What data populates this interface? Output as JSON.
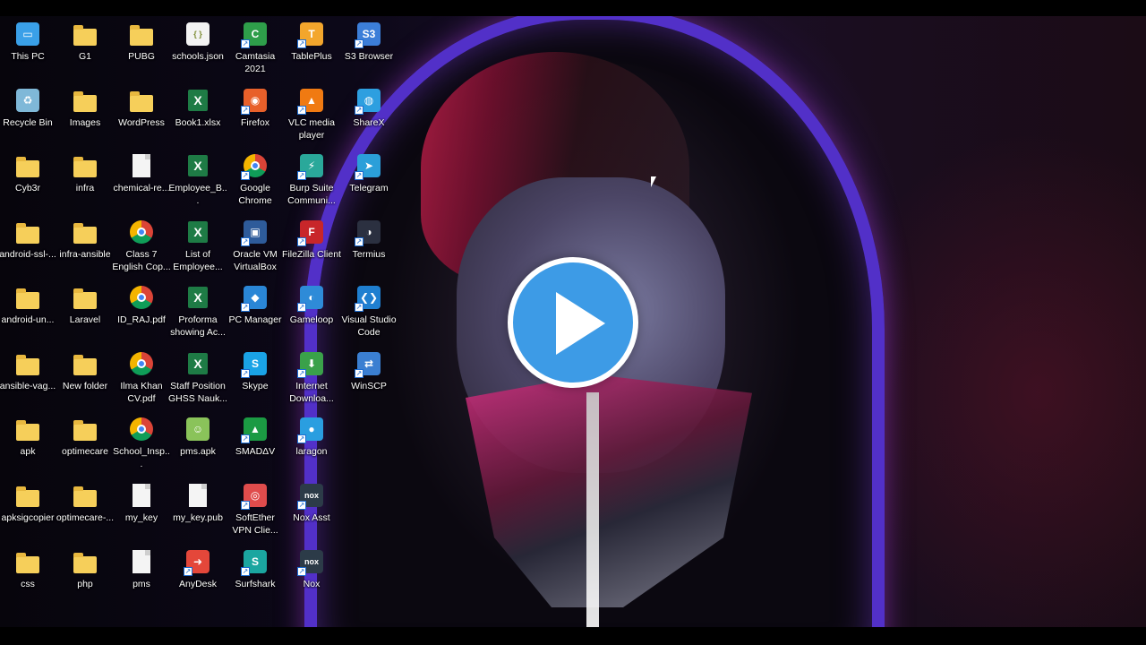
{
  "desktop": {
    "icons": [
      {
        "label": "This PC",
        "icon": "monitor-icon"
      },
      {
        "label": "Recycle Bin",
        "icon": "recycle-bin-icon"
      },
      {
        "label": "Cyb3r",
        "icon": "folder-icon"
      },
      {
        "label": "android-ssl-...",
        "icon": "folder-icon"
      },
      {
        "label": "android-un...",
        "icon": "folder-icon"
      },
      {
        "label": "ansible-vag...",
        "icon": "folder-icon"
      },
      {
        "label": "apk",
        "icon": "folder-icon"
      },
      {
        "label": "apksigcopier",
        "icon": "folder-icon"
      },
      {
        "label": "css",
        "icon": "folder-icon"
      },
      {
        "label": "G1",
        "icon": "folder-icon"
      },
      {
        "label": "Images",
        "icon": "folder-icon"
      },
      {
        "label": "infra",
        "icon": "folder-icon"
      },
      {
        "label": "infra-ansible",
        "icon": "folder-icon"
      },
      {
        "label": "Laravel",
        "icon": "folder-icon"
      },
      {
        "label": "New folder",
        "icon": "folder-icon"
      },
      {
        "label": "optimecare",
        "icon": "folder-icon"
      },
      {
        "label": "optimecare-...",
        "icon": "folder-icon"
      },
      {
        "label": "php",
        "icon": "folder-icon"
      },
      {
        "label": "PUBG",
        "icon": "folder-icon"
      },
      {
        "label": "WordPress",
        "icon": "folder-icon"
      },
      {
        "label": "chemical-re...",
        "icon": "file-icon"
      },
      {
        "label": "Class 7 English Cop...",
        "icon": "chrome-pdf-icon"
      },
      {
        "label": "ID_RAJ.pdf",
        "icon": "chrome-pdf-icon"
      },
      {
        "label": "Ilma Khan CV.pdf",
        "icon": "chrome-pdf-icon"
      },
      {
        "label": "School_Insp...",
        "icon": "chrome-pdf-icon"
      },
      {
        "label": "my_key",
        "icon": "file-icon"
      },
      {
        "label": "pms",
        "icon": "file-icon"
      },
      {
        "label": "schools.json",
        "icon": "json-file-icon"
      },
      {
        "label": "Book1.xlsx",
        "icon": "excel-icon"
      },
      {
        "label": "Employee_B...",
        "icon": "excel-icon"
      },
      {
        "label": "List of Employee...",
        "icon": "excel-icon"
      },
      {
        "label": "Proforma showing Ac...",
        "icon": "excel-icon"
      },
      {
        "label": "Staff Position GHSS Nauk...",
        "icon": "excel-icon"
      },
      {
        "label": "pms.apk",
        "icon": "android-apk-icon"
      },
      {
        "label": "my_key.pub",
        "icon": "file-icon"
      },
      {
        "label": "AnyDesk",
        "icon": "anydesk-icon"
      },
      {
        "label": "Camtasia 2021",
        "icon": "camtasia-icon"
      },
      {
        "label": "Firefox",
        "icon": "firefox-icon"
      },
      {
        "label": "Google Chrome",
        "icon": "chrome-icon"
      },
      {
        "label": "Oracle VM VirtualBox",
        "icon": "virtualbox-icon"
      },
      {
        "label": "PC Manager",
        "icon": "pc-manager-icon"
      },
      {
        "label": "Skype",
        "icon": "skype-icon"
      },
      {
        "label": "SMADΔV",
        "icon": "smadav-icon"
      },
      {
        "label": "SoftEther VPN Clie...",
        "icon": "softether-icon"
      },
      {
        "label": "Surfshark",
        "icon": "surfshark-icon"
      },
      {
        "label": "TablePlus",
        "icon": "tableplus-icon"
      },
      {
        "label": "VLC media player",
        "icon": "vlc-icon"
      },
      {
        "label": "Burp Suite Communi...",
        "icon": "burp-suite-icon"
      },
      {
        "label": "FileZilla Client",
        "icon": "filezilla-icon"
      },
      {
        "label": "Gameloop",
        "icon": "gameloop-icon"
      },
      {
        "label": "Internet Downloa...",
        "icon": "idm-icon"
      },
      {
        "label": "laragon",
        "icon": "laragon-icon"
      },
      {
        "label": "Nox Asst",
        "icon": "nox-icon"
      },
      {
        "label": "Nox",
        "icon": "nox-icon"
      },
      {
        "label": "S3 Browser",
        "icon": "s3-browser-icon"
      },
      {
        "label": "ShareX",
        "icon": "sharex-icon"
      },
      {
        "label": "Telegram",
        "icon": "telegram-icon"
      },
      {
        "label": "Termius",
        "icon": "termius-icon"
      },
      {
        "label": "Visual Studio Code",
        "icon": "vscode-icon"
      },
      {
        "label": "WinSCP",
        "icon": "winscp-icon"
      }
    ]
  },
  "video": {
    "control": "play-button-icon"
  },
  "colors": {
    "play_fill": "#3d9be6",
    "hood_glow": "#5230c8",
    "folder": "#f6cf5a"
  }
}
